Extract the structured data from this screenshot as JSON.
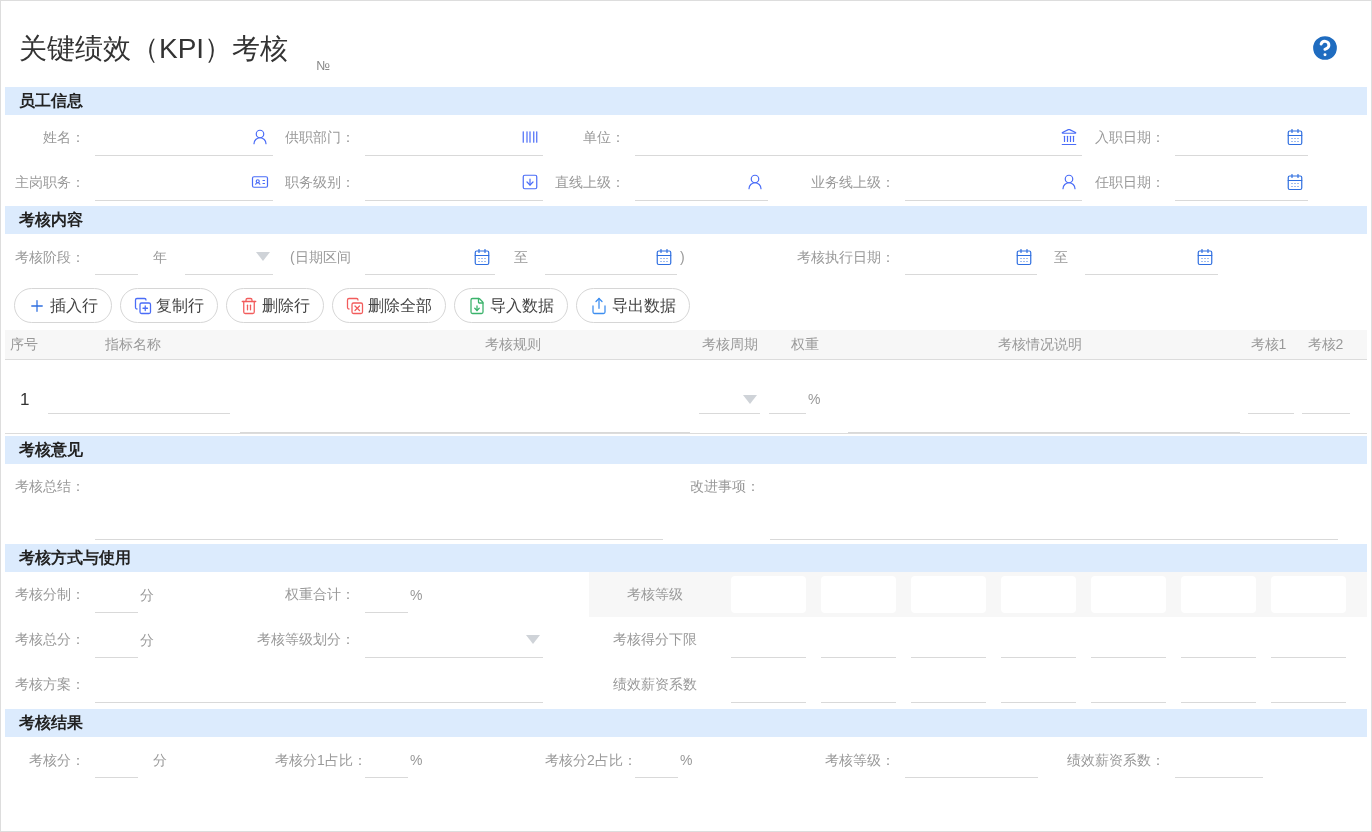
{
  "title": "关键绩效（KPI）考核",
  "number_mark": "№",
  "employee_info": {
    "heading": "员工信息",
    "fields": [
      {
        "label": "姓名：",
        "kind": "lookup"
      },
      {
        "label": "供职部门：",
        "kind": "lookup"
      },
      {
        "label": "单位：",
        "kind": "lookup"
      },
      {
        "label": "入职日期：",
        "kind": "date"
      },
      {
        "label": "主岗职务：",
        "kind": "lookup"
      },
      {
        "label": "职务级别：",
        "kind": "lookup"
      },
      {
        "label": "直线上级：",
        "kind": "lookup"
      },
      {
        "label": "业务线上级：",
        "kind": "lookup"
      },
      {
        "label": "任职日期：",
        "kind": "date"
      }
    ]
  },
  "assessment_content": {
    "heading": "考核内容",
    "rows": [
      [
        {
          "kind": "label",
          "text": "考核阶段："
        },
        {
          "kind": "input"
        },
        {
          "kind": "unit",
          "text": "年"
        },
        {
          "kind": "select"
        },
        {
          "kind": "unit",
          "text": "(日期区间"
        },
        {
          "kind": "date"
        },
        {
          "kind": "unit",
          "text": "至"
        },
        {
          "kind": "date"
        },
        {
          "kind": "unit",
          "text": ")"
        },
        {
          "kind": "label",
          "text": "考核执行日期："
        },
        {
          "kind": "date"
        },
        {
          "kind": "unit",
          "text": "至"
        },
        {
          "kind": "date"
        }
      ]
    ],
    "buttons": [
      "插入行",
      "复制行",
      "删除行",
      "删除全部",
      "导入数据",
      "导出数据"
    ],
    "table": {
      "columns": [
        "序号",
        "指标名称",
        "考核规则",
        "考核周期",
        "权重",
        "考核情况说明",
        "考核1",
        "考核2"
      ],
      "rows": [
        {
          "index": "1",
          "weight_unit": "%"
        }
      ]
    }
  },
  "opinion": {
    "heading": "考核意见",
    "summary_label": "考核总结：",
    "improvement_label": "改进事项："
  },
  "method": {
    "heading": "考核方式与使用",
    "rows": [
      {
        "items": [
          {
            "kind": "label",
            "text": "考核分制："
          },
          {
            "kind": "input"
          },
          {
            "kind": "unit",
            "text": "分"
          },
          {
            "kind": "label",
            "text": "权重合计："
          },
          {
            "kind": "input"
          },
          {
            "kind": "unit",
            "text": "%"
          }
        ],
        "grade_label": "考核等级",
        "kind": "box"
      },
      {
        "items": [
          {
            "kind": "label",
            "text": "考核总分："
          },
          {
            "kind": "input"
          },
          {
            "kind": "unit",
            "text": "分"
          },
          {
            "kind": "label",
            "text": "考核等级划分："
          },
          {
            "kind": "select"
          }
        ],
        "grade_label": "考核得分下限",
        "kind": "line"
      },
      {
        "items": [
          {
            "kind": "label",
            "text": "考核方案："
          },
          {
            "kind": "input"
          }
        ],
        "grade_label": "绩效薪资系数",
        "kind": "line"
      }
    ]
  },
  "result": {
    "heading": "考核结果",
    "rows": [
      [
        {
          "kind": "label",
          "text": "考核分："
        },
        {
          "kind": "input"
        },
        {
          "kind": "unit",
          "text": "分"
        },
        {
          "kind": "label",
          "text": "考核分1占比："
        },
        {
          "kind": "input"
        },
        {
          "kind": "unit",
          "text": "%"
        },
        {
          "kind": "label",
          "text": "考核分2占比："
        },
        {
          "kind": "input"
        },
        {
          "kind": "unit",
          "text": "%"
        },
        {
          "kind": "label",
          "text": "考核等级："
        },
        {
          "kind": "input"
        },
        {
          "kind": "label",
          "text": "绩效薪资系数："
        },
        {
          "kind": "input"
        }
      ]
    ]
  }
}
